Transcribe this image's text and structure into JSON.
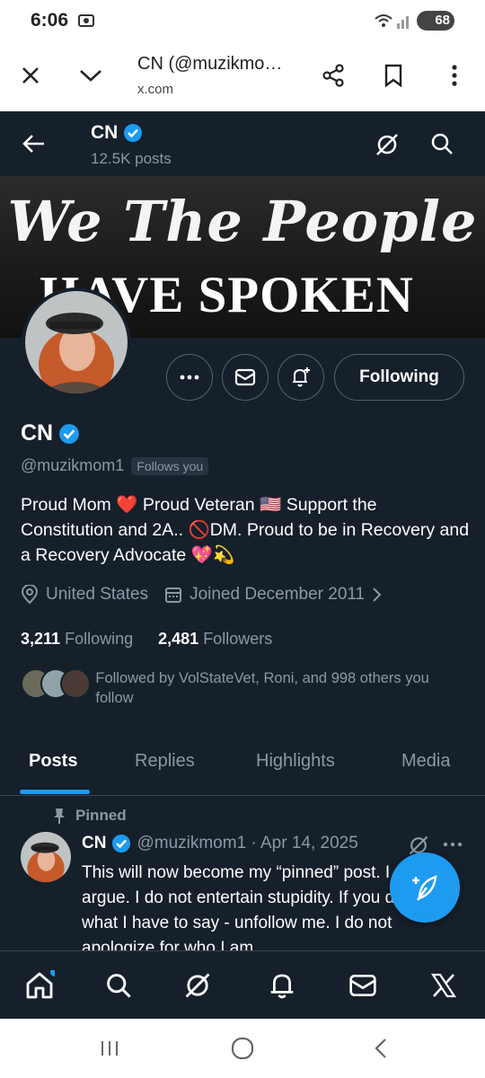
{
  "status_bar": {
    "time": "6:06",
    "battery": "68"
  },
  "browser": {
    "title": "CN (@muzikmo…",
    "url": "x.com"
  },
  "header": {
    "name": "CN",
    "posts": "12.5K posts"
  },
  "banner": {
    "line1": "We The People",
    "line2": "HAVE SPOKEN"
  },
  "actions": {
    "following_label": "Following"
  },
  "profile": {
    "name": "CN",
    "handle": "@muzikmom1",
    "follows_you": "Follows you",
    "bio": "Proud Mom ❤️ Proud Veteran 🇺🇸 Support the Constitution and 2A.. 🚫DM. Proud to be in Recovery and a Recovery Advocate 💖💫",
    "location": "United States",
    "joined": "Joined December 2011",
    "following_count": "3,211",
    "following_label": "Following",
    "followers_count": "2,481",
    "followers_label": "Followers",
    "followed_by": "Followed by VolStateVet, Roni, and 998 others you follow"
  },
  "tabs": [
    "Posts",
    "Replies",
    "Highlights",
    "Media"
  ],
  "pinned_post": {
    "pinned_label": "Pinned",
    "name": "CN",
    "handle_date": "@muzikmom1 · Apr 14, 2025",
    "text": "This will now become my “pinned” post. I do not argue. I do not entertain stupidity. If you don’t like what I have to say - unfollow me. I do not apologize for who I am."
  },
  "colors": {
    "background": "#15202b",
    "accent": "#1d9bf0",
    "verified": "#1d9bf0",
    "muted": "#8b98a5"
  }
}
